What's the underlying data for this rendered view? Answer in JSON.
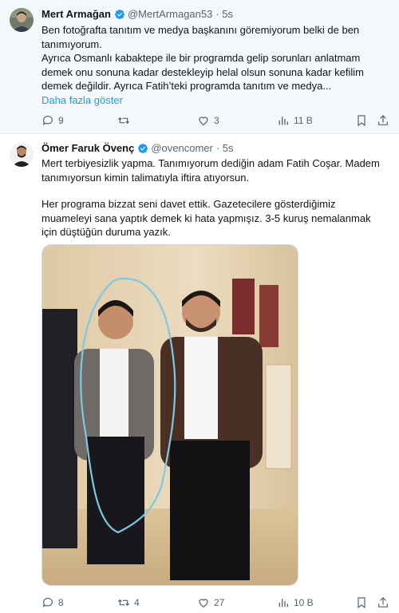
{
  "tweets": [
    {
      "name": "Mert Armağan",
      "handle": "@MertArmagan53",
      "time": "· 5s",
      "paragraphs": [
        "Ben fotoğrafta tanıtım ve medya başkanını göremiyorum belki de ben tanımıyorum.",
        "Ayrıca Osmanlı kabaktepe ile bir programda gelip sorunları anlatmam demek onu sonuna kadar destekleyip helal olsun sonuna kadar kefilim demek değildir. Ayrıca Fatih’teki programda tanıtım ve medya..."
      ],
      "show_more": "Daha fazla göster",
      "stats": {
        "replies": "9",
        "reposts": "",
        "likes": "3",
        "views": "11 B"
      }
    },
    {
      "name": "Ömer Faruk Övenç",
      "handle": "@ovencomer",
      "time": "· 5s",
      "paragraphs": [
        "Mert terbiyesizlik yapma. Tanımıyorum dediğin adam Fatih Coşar. Madem tanımıyorsun kimin talimatıyla iftira atıyorsun.",
        "Her programa bizzat seni davet ettik. Gazetecilere gösterdiğimiz muameleyi sana yaptık demek ki hata yapmışız. 3-5 kuruş nemalanmak için düştüğün duruma yazık."
      ],
      "stats": {
        "replies": "8",
        "reposts": "4",
        "likes": "27",
        "views": "10 B"
      }
    }
  ],
  "colors": {
    "verified": "#1d9bf0",
    "link": "#1d9bf0",
    "muted": "#536471",
    "annotation": "#7ec8e3"
  },
  "icons": [
    "reply-icon",
    "repost-icon",
    "like-icon",
    "views-icon",
    "bookmark-icon",
    "share-icon",
    "verified-badge-icon"
  ]
}
